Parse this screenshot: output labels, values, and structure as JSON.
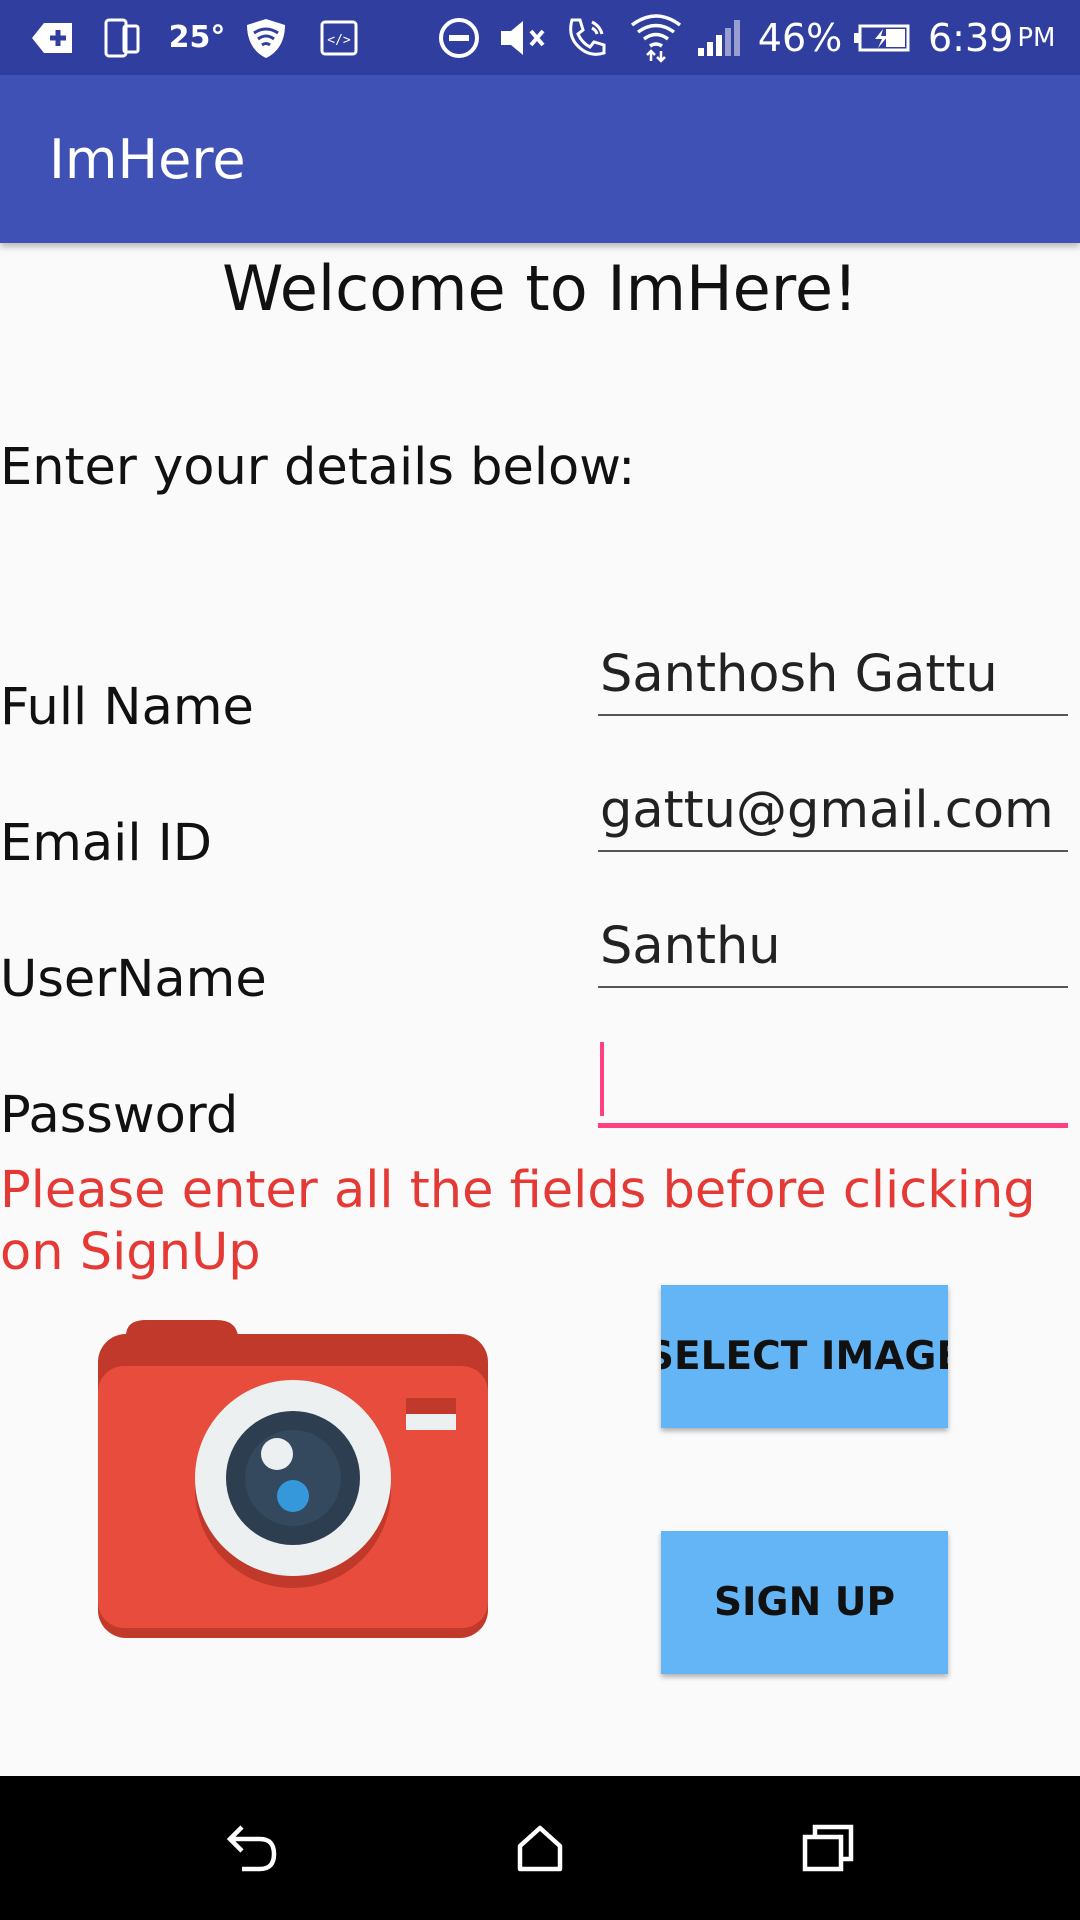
{
  "status_bar": {
    "temperature": "25°",
    "battery_percent": "46%",
    "time": "6:39",
    "time_suffix": "PM",
    "icons": [
      "add-notification-icon",
      "phone-screen-icon",
      "shield-icon",
      "code-icon",
      "do-not-disturb-icon",
      "volume-muted-icon",
      "wifi-calling-icon",
      "wifi-icon",
      "cellular-signal-icon",
      "battery-charging-icon"
    ]
  },
  "app_bar": {
    "title": "ImHere"
  },
  "content": {
    "welcome": "Welcome to ImHere!",
    "subtitle": "Enter your details below:",
    "fields": [
      {
        "label": "Full Name",
        "value": "Santhosh Gattu"
      },
      {
        "label": "Email ID",
        "value": "gattu@gmail.com"
      },
      {
        "label": "UserName",
        "value": "Santhu"
      },
      {
        "label": "Password",
        "value": ""
      }
    ],
    "error": "Please enter all the fields before clicking on SignUp",
    "buttons": {
      "select_image": "SELECT IMAGE",
      "sign_up": "SIGN UP"
    }
  },
  "nav_bar": {
    "icons": [
      "back-icon",
      "home-icon",
      "recents-icon"
    ]
  },
  "colors": {
    "status_bar": "#303f9f",
    "app_bar": "#3f51b5",
    "accent": "#ff4081",
    "error": "#e53935",
    "button": "#64b5f6",
    "camera_body": "#e74c3c"
  }
}
